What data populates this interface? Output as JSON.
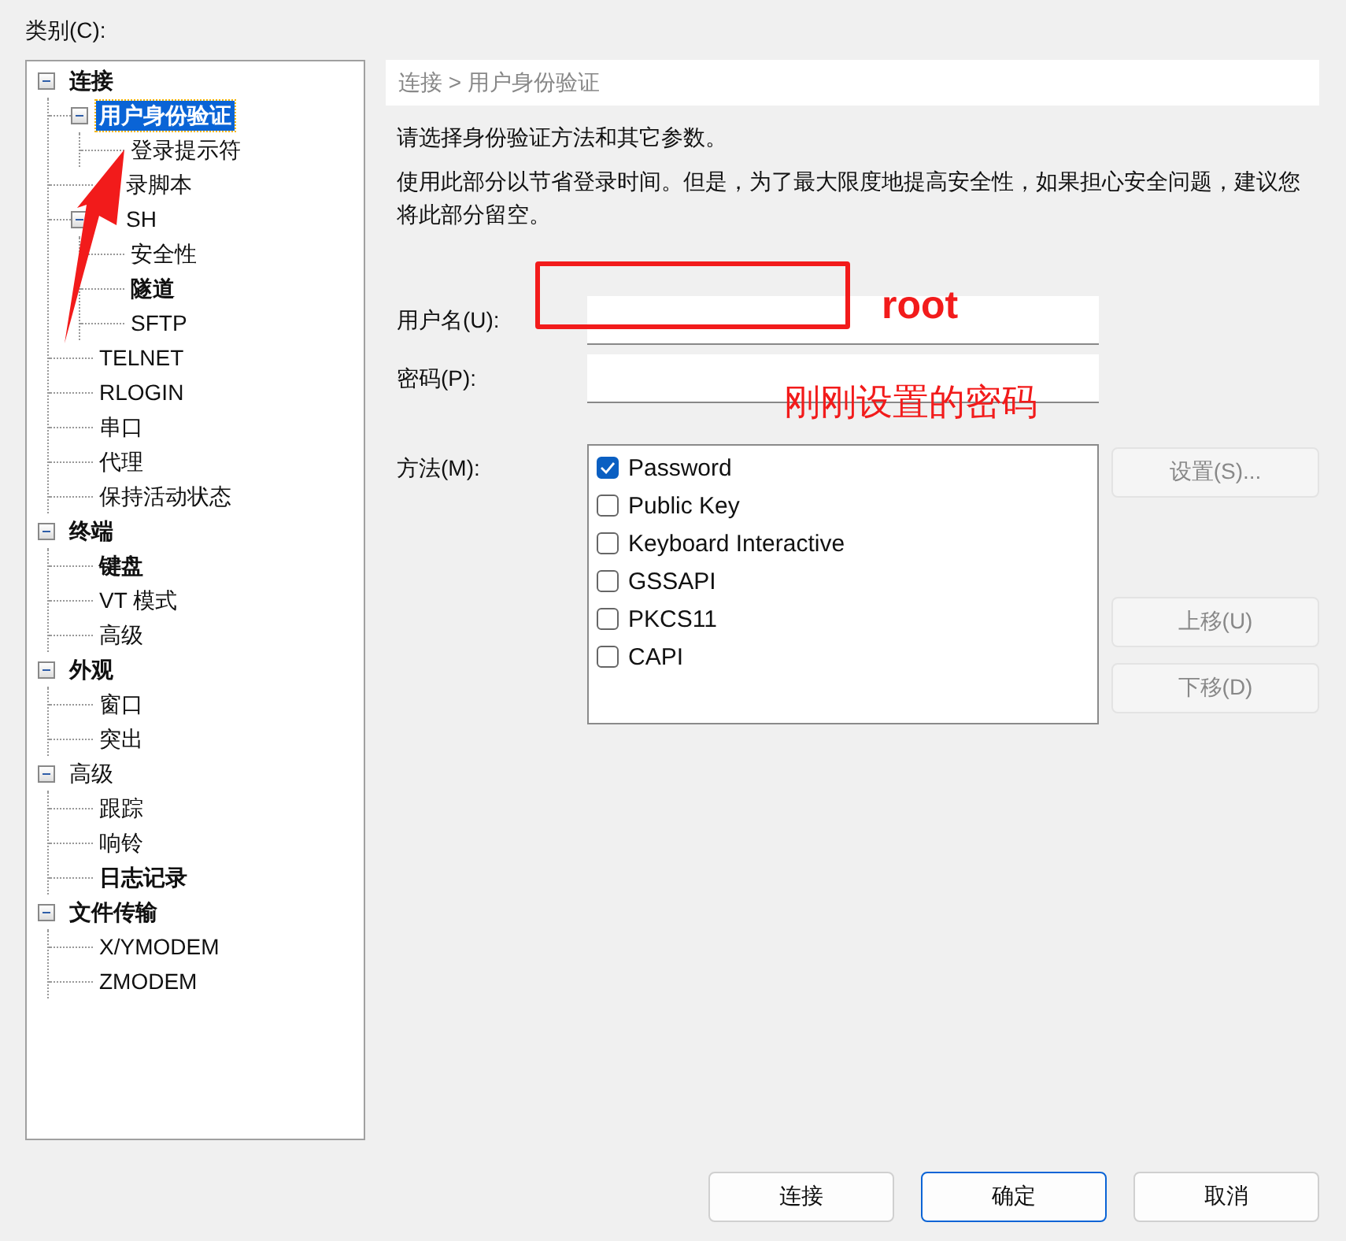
{
  "category_label": "类别(C):",
  "tree": [
    {
      "label": "连接",
      "bold": true,
      "selected": false,
      "expanded": true,
      "children": [
        {
          "label": "用户身份验证",
          "bold": true,
          "selected": true,
          "expanded": true,
          "children": [
            {
              "label": "登录提示符",
              "bold": false,
              "selected": false
            }
          ]
        },
        {
          "label": "录脚本",
          "bold": false,
          "selected": false,
          "covered": true
        },
        {
          "label": "SH",
          "bold": false,
          "selected": false,
          "covered": true,
          "expanded": true,
          "children": [
            {
              "label": "安全性",
              "bold": false,
              "selected": false
            },
            {
              "label": "隧道",
              "bold": true,
              "selected": false
            },
            {
              "label": "SFTP",
              "bold": false,
              "selected": false
            }
          ]
        },
        {
          "label": "TELNET",
          "bold": false,
          "selected": false
        },
        {
          "label": "RLOGIN",
          "bold": false,
          "selected": false
        },
        {
          "label": "串口",
          "bold": false,
          "selected": false
        },
        {
          "label": "代理",
          "bold": false,
          "selected": false
        },
        {
          "label": "保持活动状态",
          "bold": false,
          "selected": false
        }
      ]
    },
    {
      "label": "终端",
      "bold": true,
      "selected": false,
      "expanded": true,
      "children": [
        {
          "label": "键盘",
          "bold": true,
          "selected": false
        },
        {
          "label": "VT 模式",
          "bold": false,
          "selected": false
        },
        {
          "label": "高级",
          "bold": false,
          "selected": false
        }
      ]
    },
    {
      "label": "外观",
      "bold": true,
      "selected": false,
      "expanded": true,
      "children": [
        {
          "label": "窗口",
          "bold": false,
          "selected": false
        },
        {
          "label": "突出",
          "bold": false,
          "selected": false
        }
      ]
    },
    {
      "label": "高级",
      "bold": false,
      "selected": false,
      "expanded": true,
      "children": [
        {
          "label": "跟踪",
          "bold": false,
          "selected": false
        },
        {
          "label": "响铃",
          "bold": false,
          "selected": false
        },
        {
          "label": "日志记录",
          "bold": true,
          "selected": false
        }
      ]
    },
    {
      "label": "文件传输",
      "bold": true,
      "selected": false,
      "expanded": true,
      "children": [
        {
          "label": "X/YMODEM",
          "bold": false,
          "selected": false
        },
        {
          "label": "ZMODEM",
          "bold": false,
          "selected": false
        }
      ]
    }
  ],
  "breadcrumb": "连接 > 用户身份验证",
  "intro": "请选择身份验证方法和其它参数。",
  "note": "使用此部分以节省登录时间。但是，为了最大限度地提高安全性，如果担心安全问题，建议您将此部分留空。",
  "username": {
    "label": "用户名(U):"
  },
  "password": {
    "label": "密码(P):"
  },
  "method": {
    "label": "方法(M):",
    "options": [
      {
        "label": "Password",
        "checked": true
      },
      {
        "label": "Public Key",
        "checked": false
      },
      {
        "label": "Keyboard Interactive",
        "checked": false
      },
      {
        "label": "GSSAPI",
        "checked": false
      },
      {
        "label": "PKCS11",
        "checked": false
      },
      {
        "label": "CAPI",
        "checked": false
      }
    ]
  },
  "side_buttons": [
    {
      "label": "设置(S)...",
      "disabled": true
    },
    {
      "label": "上移(U)",
      "disabled": true
    },
    {
      "label": "下移(D)",
      "disabled": true
    }
  ],
  "buttons": [
    {
      "label": "连接",
      "default": false
    },
    {
      "label": "确定",
      "default": true
    },
    {
      "label": "取消",
      "default": false
    }
  ],
  "annotations": [
    {
      "kind": "box"
    },
    {
      "kind": "text",
      "text": "root"
    },
    {
      "kind": "text",
      "text": "刚刚设置的密码"
    },
    {
      "kind": "arrow"
    }
  ]
}
